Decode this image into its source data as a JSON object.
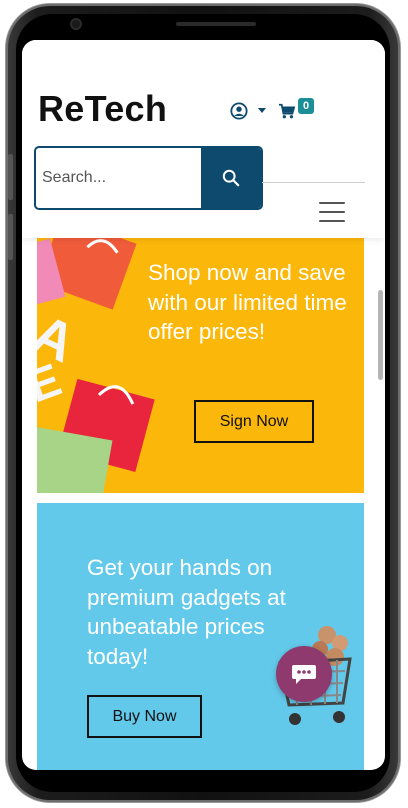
{
  "app": {
    "logo_text": "ReTech"
  },
  "header": {
    "cart_count": "0",
    "search_placeholder": "Search...",
    "icons": [
      "user-icon",
      "caret-down-icon",
      "cart-icon",
      "search-icon",
      "hamburger-menu-icon"
    ]
  },
  "banners": [
    {
      "text": "Shop now and save with our limited time offer prices!",
      "button_label": "Sign Now",
      "background": "#fbb70a"
    },
    {
      "text": "Get your hands on premium gadgets at unbeatable prices today!",
      "button_label": "Buy Now",
      "background": "#63c9ea"
    }
  ],
  "chat": {
    "icon": "chat-icon",
    "color": "#8e3a6e"
  },
  "colors": {
    "primary": "#0d4a6e",
    "badge": "#1a8f98"
  }
}
